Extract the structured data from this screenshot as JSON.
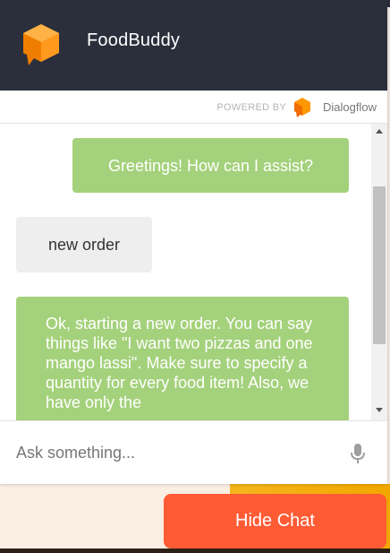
{
  "app": {
    "title": "FoodBuddy",
    "logo_icon": "cube-chat-icon",
    "accent": "#ff8c00"
  },
  "powered": {
    "label": "POWERED BY",
    "brand": "Dialogflow",
    "brand_icon": "dialogflow-icon"
  },
  "messages": [
    {
      "from": "bot",
      "text": "Greetings! How can I assist?"
    },
    {
      "from": "user",
      "text": "new order"
    },
    {
      "from": "bot",
      "text": "Ok, starting a new order. You can say things like \"I want two pizzas and one mango lassi\". Make sure to specify a quantity for every food item! Also, we have only the"
    }
  ],
  "input": {
    "placeholder": "Ask something...",
    "value": "",
    "mic_icon": "microphone-icon"
  },
  "hide_button": {
    "label": "Hide Chat",
    "color": "#ff5b35"
  },
  "colors": {
    "header": "#2b2f3c",
    "bot_bubble": "#a4d17b",
    "user_bubble": "#eeeeee"
  }
}
